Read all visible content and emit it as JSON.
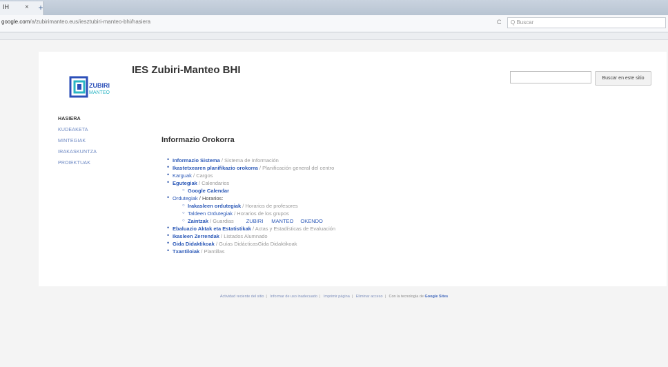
{
  "browser": {
    "tab_title": "IH",
    "tab_close": "×",
    "new_tab": "+",
    "url": "google.com/a/zubirimanteo.eus/iesztubiri-manteo-bhi/hasiera",
    "url_host": "google.com",
    "url_path": "/a/zubirimanteo.eus/iesztubiri-manteo-bhi/hasiera",
    "reload": "C",
    "search_placeholder": "Q Buscar"
  },
  "header": {
    "title": "IES Zubiri-Manteo BHI",
    "logo_text_top": "ZUBIRI",
    "logo_text_bottom": "MANTEO",
    "search_button": "Buscar en este sitio"
  },
  "sidebar": {
    "items": [
      {
        "label": "HASIERA"
      },
      {
        "label": "KUDEAKETA"
      },
      {
        "label": "MINTEGIAK"
      },
      {
        "label": "IRAKASKUNTZA"
      },
      {
        "label": "PROIEKTUAK"
      }
    ]
  },
  "content": {
    "heading": "Informazio Orokorra",
    "items": [
      {
        "k": "Informazio Sistema",
        "t": " / Sistema de Información"
      },
      {
        "k": "Ikastetxearen planifikazio orokorra",
        "t": " / Planificación general del centro"
      },
      {
        "k": "Karguak",
        "t": " / Cargos"
      },
      {
        "k": "Egutegiak",
        "t": " / Calendarios"
      },
      {
        "k": "Google Calendar",
        "t": ""
      },
      {
        "k": "Ordutegiak",
        "t": " / Horarios:"
      },
      {
        "k": "Irakasleen ordutegiak",
        "t": " / Horarios de profesores"
      },
      {
        "k": "Taldeen Ordutegiak",
        "t": " / Horarios de los grupos"
      },
      {
        "k": "Zaintzak",
        "t": " / Guardias",
        "links": [
          "ZUBIRI",
          "MANTEO",
          "OKENDO"
        ]
      },
      {
        "k": "Ebaluazio Aktak eta Estatistikak",
        "t": " / Actas y Estadísticas de Evaluación"
      },
      {
        "k": "Ikasleen Zerrendak",
        "t": " / Listados Alumnado"
      },
      {
        "k": "Gida Didaktikoak",
        "t": " / Guías DidácticasGida Didaktikoak"
      },
      {
        "k": "Txantiloiak",
        "t": " / Plantillas"
      }
    ]
  },
  "footer": {
    "links": [
      "Actividad reciente del sitio",
      "Informar de uso inadecuado",
      "Imprimir página",
      "Eliminar acceso"
    ],
    "powered": "Con la tecnología de",
    "brand": "Google Sites"
  },
  "colors": {
    "link": "#2c59b7",
    "sidebar_link": "#6a86c2",
    "logo_blue": "#2b4fb8",
    "logo_teal": "#2ab5c4"
  }
}
